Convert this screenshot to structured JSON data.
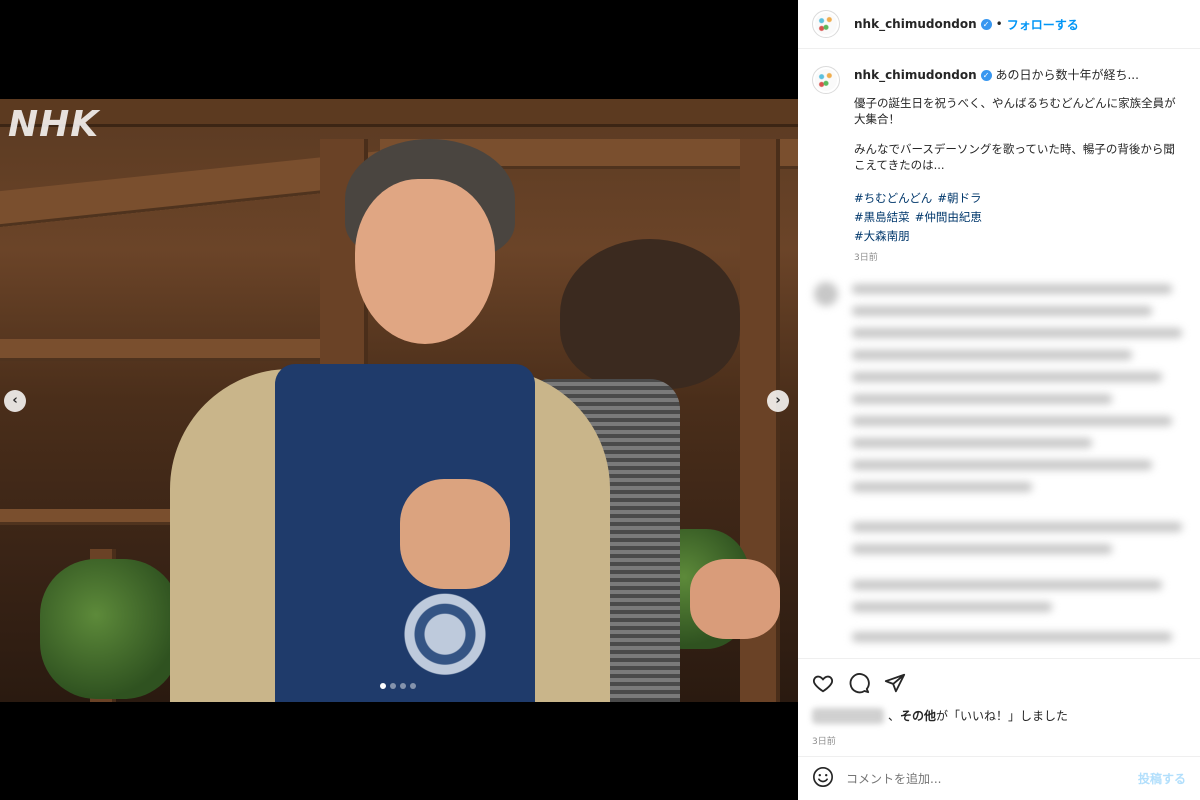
{
  "header": {
    "username": "nhk_chimudondon",
    "separator": "•",
    "follow_label": "フォローする"
  },
  "media": {
    "watermark": "NHK",
    "prev_icon": "chevron-left-icon",
    "next_icon": "chevron-right-icon",
    "dot_count": 4,
    "active_dot": 1
  },
  "caption": {
    "username": "nhk_chimudondon",
    "title": "あの日から数十年が経ち...",
    "line1": "優子の誕生日を祝うべく、やんばるちむどんどんに家族全員が",
    "line2": "大集合！",
    "line3": "みんなでバースデーソングを歌っていた時、暢子の背後から聞",
    "line4": "こえてきたのは...",
    "tags_row1": [
      "#ちむどんどん",
      "#朝ドラ"
    ],
    "tags_row2": [
      "#黒島結菜",
      "#仲間由紀恵"
    ],
    "tags_row3": [
      "#大森南朋"
    ],
    "time": "3日前"
  },
  "actions": {
    "like_icon": "heart-icon",
    "comment_icon": "comment-icon",
    "share_icon": "send-icon",
    "likes_prefix": "、",
    "likes_bold": "その他",
    "likes_suffix": "が「いいね！」しました",
    "post_time": "3日前"
  },
  "comment_box": {
    "emoji_icon": "smiley-icon",
    "placeholder": "コメントを追加...",
    "post_label": "投稿する"
  },
  "colors": {
    "accent": "#0095f6",
    "verified": "#3897f0",
    "hashtag": "#00376b"
  }
}
